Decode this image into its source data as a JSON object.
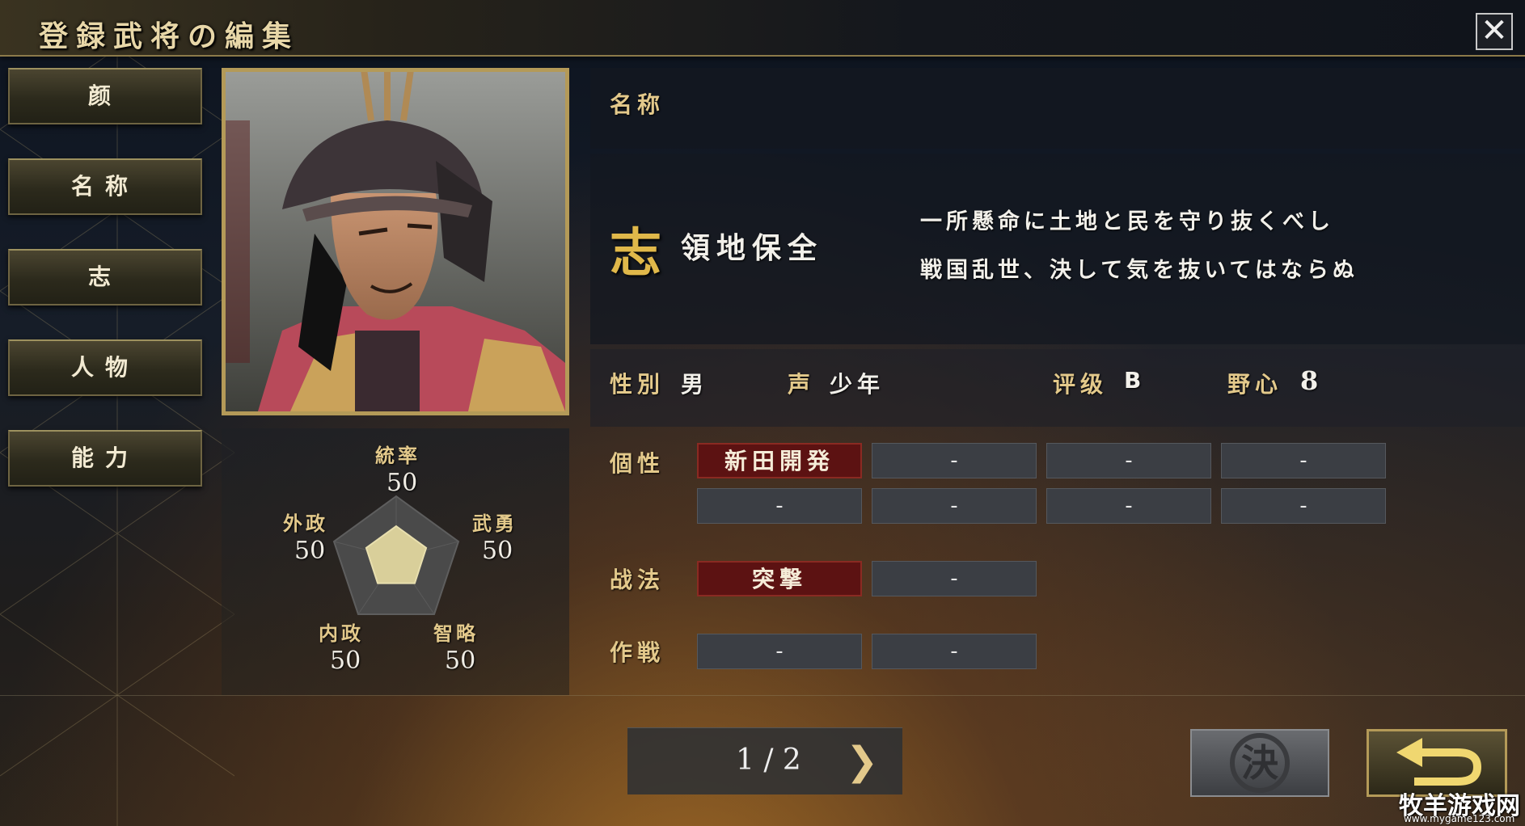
{
  "window": {
    "title": "登録武将の編集",
    "close_icon": "close-icon"
  },
  "sidebar": {
    "items": [
      {
        "label": "颜"
      },
      {
        "label": "名称"
      },
      {
        "label": "志"
      },
      {
        "label": "人物"
      },
      {
        "label": "能力"
      }
    ]
  },
  "portrait": {
    "subject": "samurai-portrait"
  },
  "name_panel": {
    "label": "名称",
    "value": ""
  },
  "ambition_panel": {
    "icon_char": "志",
    "ambition": "領地保全",
    "quote_line1": "一所懸命に土地と民を守り抜くべし",
    "quote_line2": "戦国乱世、決して気を抜いてはならぬ"
  },
  "profile": {
    "gender_label": "性別",
    "gender_value": "男",
    "voice_label": "声",
    "voice_value": "少年",
    "rank_label": "评级",
    "rank_value": "B",
    "ambition_label": "野心",
    "ambition_value": "8"
  },
  "traits": {
    "label": "個性",
    "slots": [
      "新田開発",
      "-",
      "-",
      "-",
      "-",
      "-",
      "-",
      "-"
    ]
  },
  "tactics": {
    "label": "战法",
    "slots": [
      "突撃",
      "-"
    ]
  },
  "strategy": {
    "label": "作戦",
    "slots": [
      "-",
      "-"
    ]
  },
  "stats": {
    "leadership": {
      "label": "統率",
      "value": 50
    },
    "valor": {
      "label": "武勇",
      "value": 50
    },
    "intellect": {
      "label": "智略",
      "value": 50
    },
    "politics": {
      "label": "内政",
      "value": 50
    },
    "diplomacy": {
      "label": "外政",
      "value": 50
    },
    "max": 100
  },
  "pager": {
    "text": "1 / 2",
    "next_icon": "chevron-right-icon"
  },
  "actions": {
    "decide_char": "決",
    "back_icon": "return-arrow-icon"
  },
  "watermark": {
    "text": "牧羊游戏网",
    "url": "www.mygame123.com"
  },
  "colors": {
    "gold": "#e3c98b",
    "frame_gold": "#b49a58",
    "trait_red": "#5c1212",
    "radar_fill": "#d9cf9a"
  }
}
